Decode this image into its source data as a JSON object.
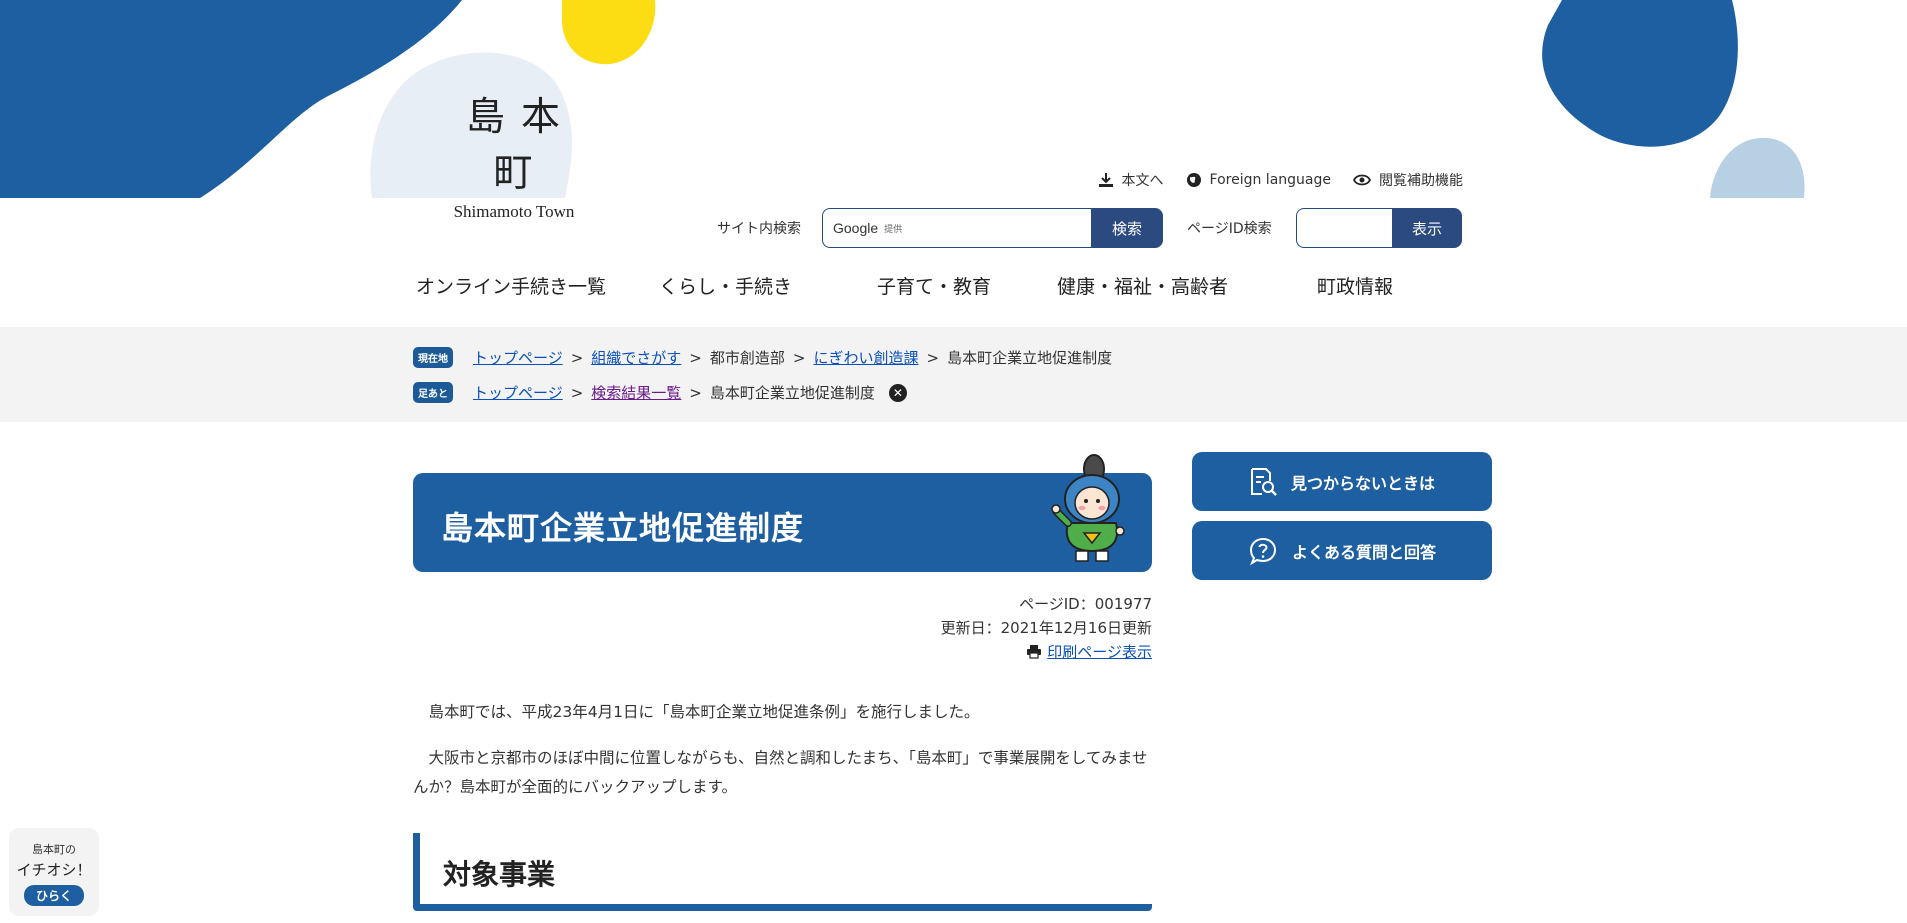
{
  "header": {
    "logo_jp": "島本町",
    "logo_en": "Shimamoto Town"
  },
  "utility": {
    "skip_label": "本文へ",
    "foreign_label": "Foreign language",
    "accessibility_label": "閲覧補助機能"
  },
  "search": {
    "site_label": "サイト内検索",
    "google_text": "Google",
    "google_sub": "提供",
    "search_button": "検索",
    "page_id_label": "ページID検索",
    "display_button": "表示"
  },
  "nav": {
    "items": [
      {
        "label": "オンライン手続き一覧"
      },
      {
        "label": "くらし・手続き"
      },
      {
        "label": "子育て・教育"
      },
      {
        "label": "健康・福祉・高齢者"
      },
      {
        "label": "町政情報"
      }
    ]
  },
  "breadcrumb": {
    "current_badge": "現在地",
    "current": [
      "トップページ",
      "組織でさがす",
      "都市創造部",
      "にぎわい創造課",
      "島本町企業立地促進制度"
    ],
    "footprint_badge": "足あと",
    "footprint": [
      "トップページ",
      "検索結果一覧",
      "島本町企業立地促進制度"
    ],
    "separator": ">"
  },
  "page": {
    "title": "島本町企業立地促進制度",
    "page_id": "ページID：001977",
    "updated": "更新日：2021年12月16日更新",
    "print_label": "印刷ページ表示",
    "paragraph1": "島本町では、平成23年4月1日に「島本町企業立地促進条例」を施行しました。",
    "paragraph2": "大阪市と京都市のほぼ中間に位置しながらも、自然と調和したまち、「島本町」で事業展開をしてみませんか？島本町が全面的にバックアップします。",
    "section_heading": "対象事業"
  },
  "sidebar": {
    "not_found_label": "見つからないときは",
    "faq_label": "よくある質問と回答"
  },
  "oshi": {
    "line1": "島本町の",
    "line2": "イチオシ！",
    "button": "ひらく"
  },
  "colors": {
    "brand_blue": "#1d5fa0",
    "dark_blue": "#2a4a80",
    "yellow": "#fcdc12",
    "light_blob": "#e8eef6",
    "pale_blue_blob": "#b8d0e4",
    "link": "#0a50b8",
    "visited_link": "#6a1b8a",
    "band_gray": "#f3f3f3"
  }
}
